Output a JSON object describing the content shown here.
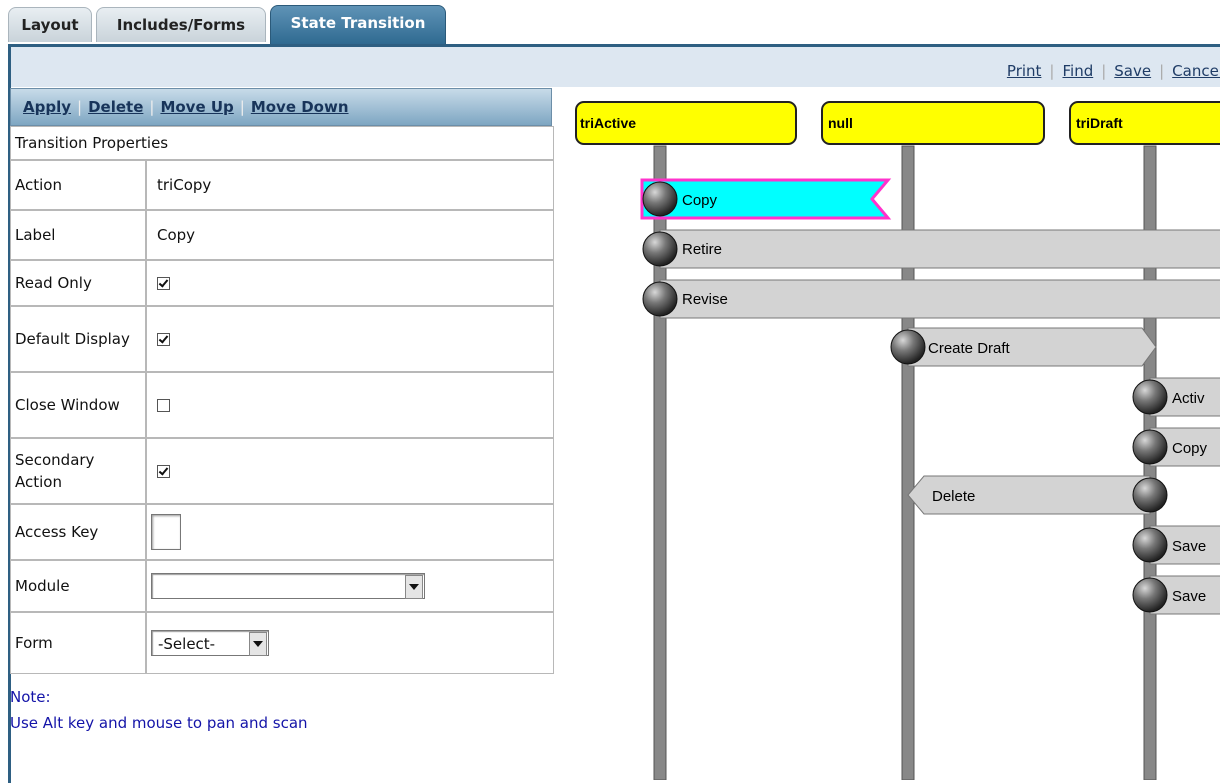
{
  "tabs": [
    {
      "label": "Layout"
    },
    {
      "label": "Includes/Forms"
    },
    {
      "label": "State Transition"
    }
  ],
  "toolbar": {
    "print": "Print",
    "find": "Find",
    "save": "Save",
    "cancel": "Cancel"
  },
  "actions": {
    "apply": "Apply",
    "delete": "Delete",
    "move_up": "Move Up",
    "move_down": "Move Down"
  },
  "properties": {
    "header": "Transition Properties",
    "action": {
      "label": "Action",
      "value": "triCopy"
    },
    "label": {
      "label": "Label",
      "value": "Copy"
    },
    "read_only": {
      "label": "Read Only",
      "checked": true
    },
    "default_display": {
      "label": "Default Display",
      "checked": true
    },
    "close_window": {
      "label": "Close Window",
      "checked": false
    },
    "secondary_action": {
      "label": "Secondary Action",
      "checked": true
    },
    "access_key": {
      "label": "Access Key",
      "value": ""
    },
    "module": {
      "label": "Module",
      "value": ""
    },
    "form": {
      "label": "Form",
      "value": "-Select-"
    }
  },
  "note": {
    "title": "Note:",
    "text": "Use Alt key and mouse to pan and scan"
  },
  "diagram": {
    "states": [
      "triActive",
      "null",
      "triDraft"
    ],
    "transitions": [
      "Copy",
      "Retire",
      "Revise",
      "Create Draft",
      "Activ",
      "Copy",
      "Delete",
      "Save",
      "Save"
    ],
    "colors": {
      "state_fill": "#ffff00",
      "selected_fill": "#00ffff",
      "selected_border": "#ff33cc",
      "transition_fill": "#d3d3d3"
    }
  }
}
